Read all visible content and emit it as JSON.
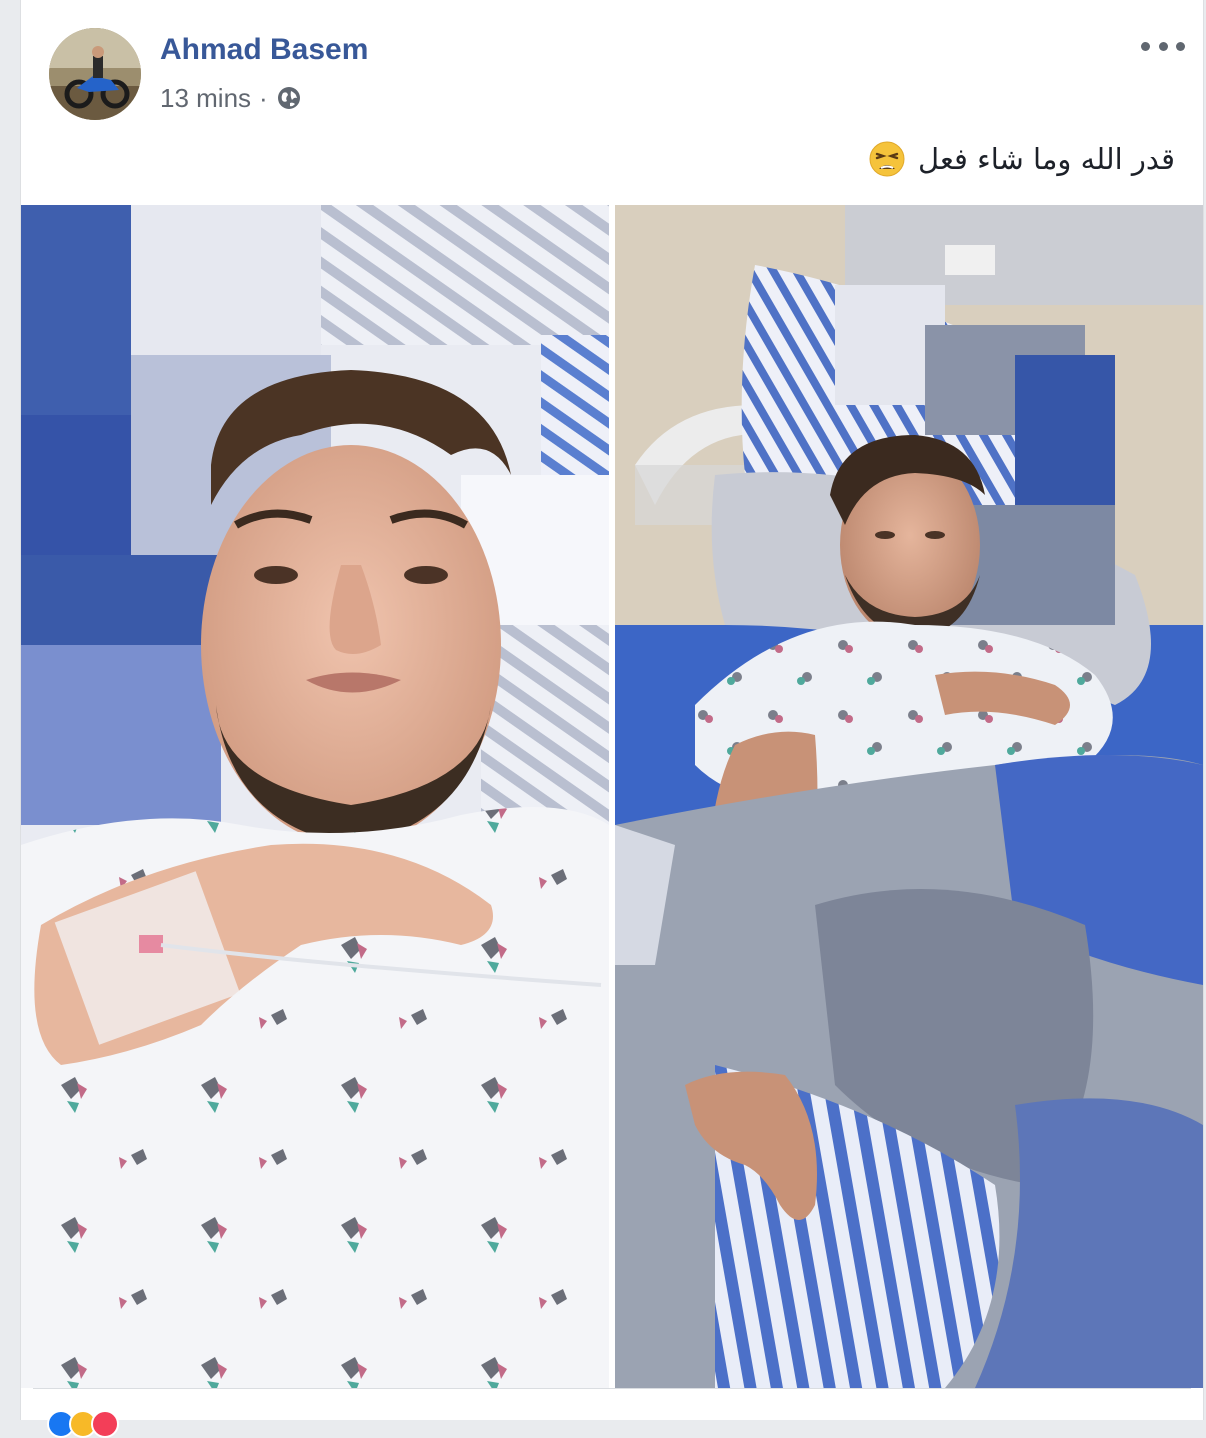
{
  "post": {
    "author": "Ahmad Basem",
    "time": "13 mins",
    "separator": "·",
    "privacy_icon": "globe-icon",
    "more_icon": "more-options-icon",
    "text": "قدر الله وما شاء فعل",
    "emoji": "tired-face-emoji"
  },
  "reactions": {
    "icons": [
      "like-icon",
      "haha-icon",
      "love-icon"
    ],
    "colors": [
      "#1877f2",
      "#f7b928",
      "#f33e58"
    ]
  },
  "colors": {
    "author_link": "#385898",
    "meta_text": "#616770",
    "body_text": "#1d2129",
    "background": "#e9ebee"
  }
}
